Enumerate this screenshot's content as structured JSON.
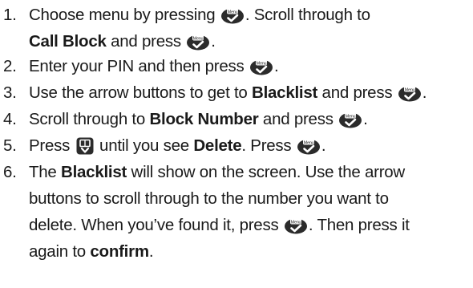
{
  "steps": [
    {
      "number": "1.",
      "line1_a": "Choose menu by pressing ",
      "line1_b": ". Scroll through to",
      "line2_bold": "Call Block",
      "line2_b": " and press ",
      "line2_c": "."
    },
    {
      "number": "2.",
      "text_a": "Enter your PIN and then press ",
      "text_b": "."
    },
    {
      "number": "3.",
      "text_a": "Use the arrow buttons to get to ",
      "bold": "Blacklist",
      "text_b": " and press ",
      "text_c": "."
    },
    {
      "number": "4.",
      "text_a": "Scroll through to ",
      "bold": "Block Number",
      "text_b": " and press ",
      "text_c": "."
    },
    {
      "number": "5.",
      "text_a": "Press ",
      "text_b": " until you see ",
      "bold": "Delete",
      "text_c": ". Press ",
      "text_d": "."
    },
    {
      "number": "6.",
      "line1_a": "The ",
      "line1_bold": "Blacklist",
      "line1_b": " will show on the screen. Use the arrow",
      "line2": "buttons to scroll through to the number you want to",
      "line3_a": "delete. When you’ve found it, press ",
      "line3_b": ". Then press it",
      "line4_a": "again to ",
      "line4_bold": "confirm",
      "line4_b": "."
    }
  ],
  "icons": {
    "menu_key": "menu-ok-key-icon",
    "menu_key_label": "Menu",
    "down_key": "down-phonebook-key-icon"
  },
  "colors": {
    "text": "#1a1a1a",
    "key_fill": "#2b2b2b",
    "key_symbol": "#ffffff"
  }
}
